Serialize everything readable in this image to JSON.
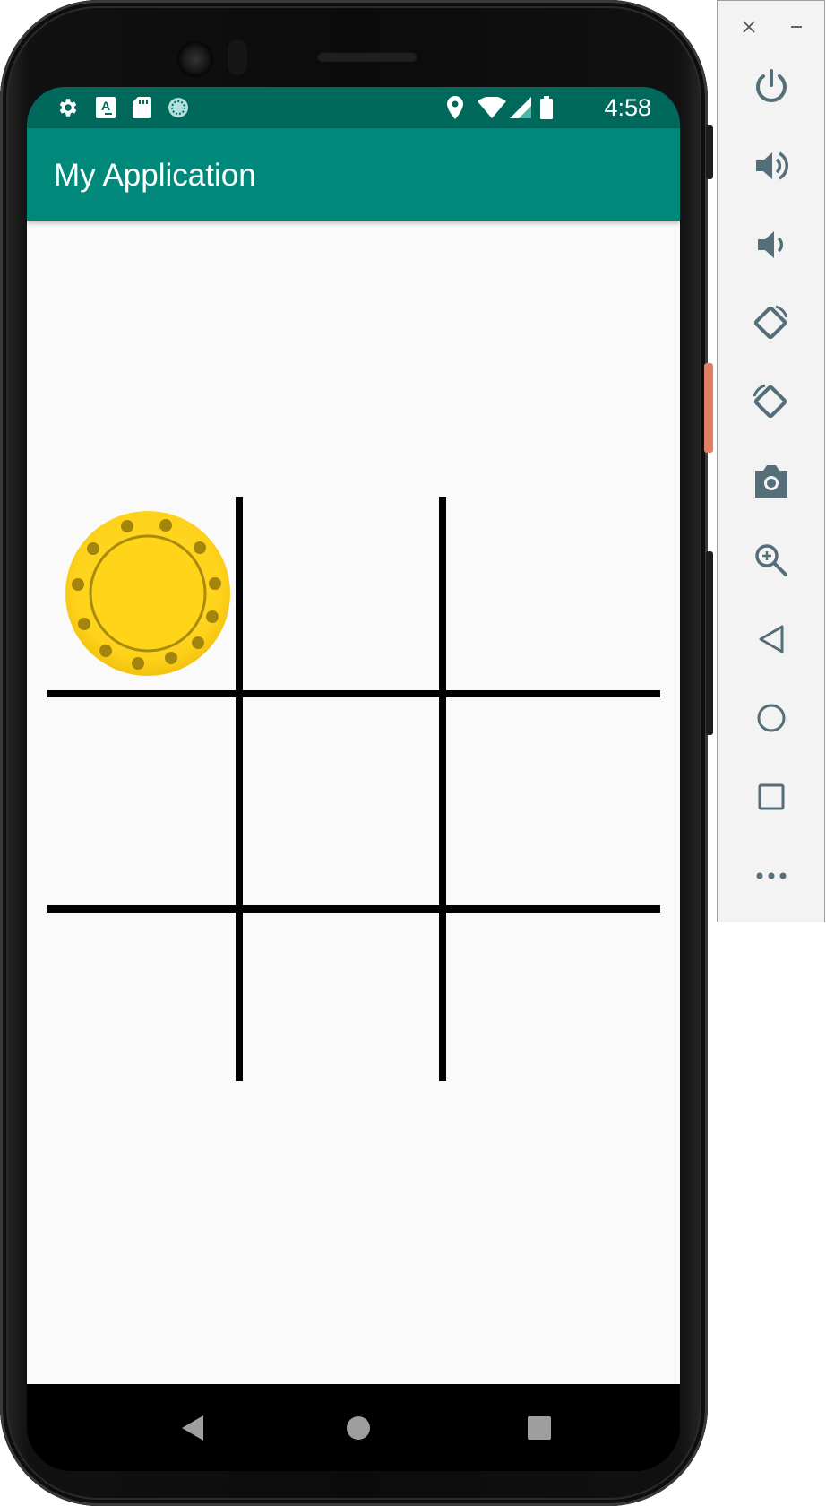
{
  "status_bar": {
    "time": "4:58",
    "left_icons": [
      "settings-icon",
      "keyboard-a-icon",
      "sd-card-icon",
      "sync-icon"
    ],
    "right_icons": [
      "location-icon",
      "wifi-icon",
      "cell-signal-icon",
      "battery-icon"
    ]
  },
  "app_bar": {
    "title": "My Application"
  },
  "board": {
    "game": "tic-tac-toe",
    "cells": [
      "coin",
      "",
      "",
      "",
      "",
      "",
      "",
      "",
      ""
    ],
    "coin_color": "#ffd31c"
  },
  "nav_bar": {
    "buttons": [
      "back-triangle-icon",
      "home-circle-icon",
      "recents-square-icon"
    ]
  },
  "emulator_panel": {
    "window_buttons": [
      "close-icon",
      "minimize-icon"
    ],
    "tools": [
      "power-icon",
      "volume-up-icon",
      "volume-down-icon",
      "rotate-left-icon",
      "rotate-right-icon",
      "camera-icon",
      "zoom-icon",
      "back-icon",
      "home-icon",
      "overview-icon",
      "more-icon"
    ]
  },
  "colors": {
    "status_bar": "#00695c",
    "app_bar": "#00897b",
    "content_bg": "#fafafa",
    "panel_icon": "#546e7a"
  }
}
